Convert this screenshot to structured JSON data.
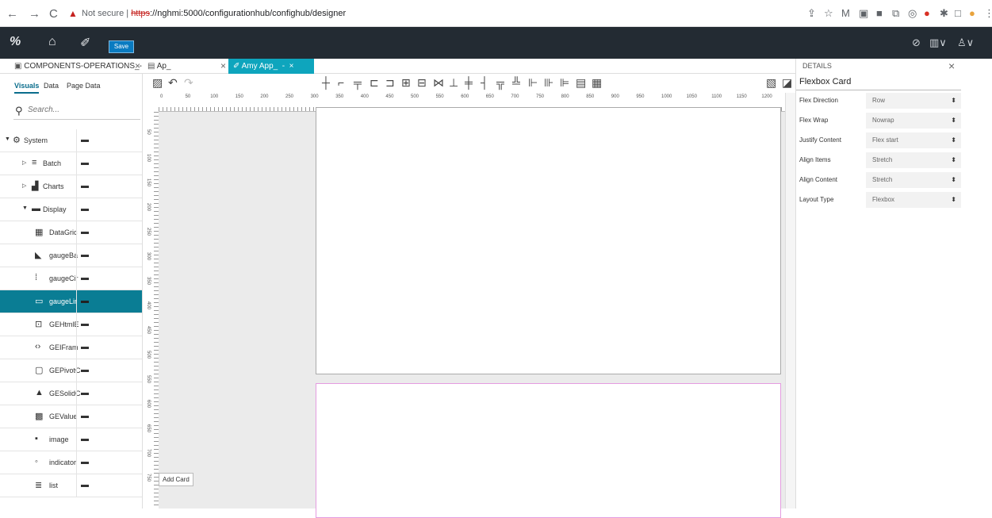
{
  "browser": {
    "not_secure": "Not secure",
    "url_scheme": "https",
    "url_rest": "://nghmi:5000/configurationhub/confighub/designer",
    "url_sep": " | "
  },
  "appbar": {
    "save_label": "Save"
  },
  "tabs": [
    {
      "label": "COMPONENTS-OPERATIONS_-"
    },
    {
      "label": "Ap_"
    },
    {
      "label": "Amy App_"
    }
  ],
  "left_panel": {
    "tabs": [
      "Visuals",
      "Data",
      "Page Data"
    ],
    "search_placeholder": "Search..."
  },
  "tree": [
    {
      "label": "System"
    },
    {
      "label": "Batch"
    },
    {
      "label": "Charts"
    },
    {
      "label": "Display"
    },
    {
      "label": "DataGric"
    },
    {
      "label": "gaugeBa"
    },
    {
      "label": "gaugeCir"
    },
    {
      "label": "gaugeLir"
    },
    {
      "label": "GEHtmlE"
    },
    {
      "label": "GEIFram"
    },
    {
      "label": "GEPivotC"
    },
    {
      "label": "GESolidC"
    },
    {
      "label": "GEValue"
    },
    {
      "label": "image"
    },
    {
      "label": "indicator"
    },
    {
      "label": "list"
    }
  ],
  "ruler": {
    "h": [
      "0",
      "50",
      "100",
      "150",
      "200",
      "250",
      "300",
      "350",
      "400",
      "450",
      "500",
      "550",
      "600",
      "650",
      "700",
      "750",
      "800",
      "850",
      "900",
      "950",
      "1000",
      "1050",
      "1100",
      "1150",
      "1200"
    ],
    "v": [
      "50",
      "100",
      "150",
      "200",
      "250",
      "300",
      "350",
      "400",
      "450",
      "500",
      "550",
      "600",
      "650",
      "700",
      "750"
    ]
  },
  "canvas": {
    "add_card": "Add Card"
  },
  "details": {
    "title": "DETAILS",
    "subtitle": "Flexbox Card",
    "props": [
      {
        "label": "Flex Direction",
        "value": "Row"
      },
      {
        "label": "Flex Wrap",
        "value": "Nowrap"
      },
      {
        "label": "Justify Content",
        "value": "Flex start"
      },
      {
        "label": "Align Items",
        "value": "Stretch"
      },
      {
        "label": "Align Content",
        "value": "Stretch"
      },
      {
        "label": "Layout Type",
        "value": "Flexbox"
      }
    ]
  },
  "colors": {
    "accent": "#0a7d94",
    "header": "#232b33",
    "tab_active": "#0ea5bd",
    "save": "#0a7bc1",
    "card_selected": "#e49ce0"
  }
}
